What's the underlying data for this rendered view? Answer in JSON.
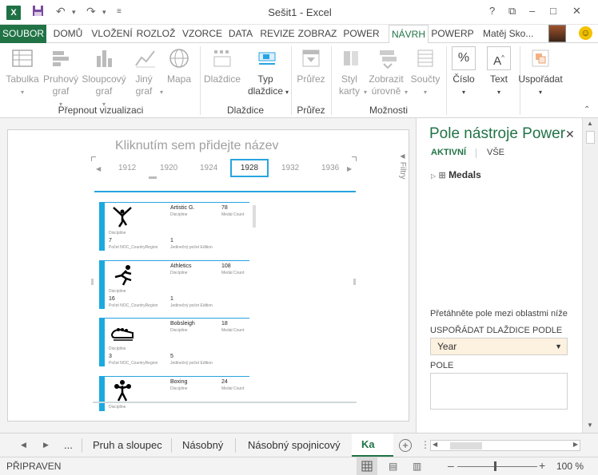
{
  "window": {
    "title": "Sešit1 - Excel",
    "help": "?",
    "minimize": "–",
    "restore": "□",
    "close": "✕",
    "ribbon_options": "⧉"
  },
  "menu": {
    "tabs": [
      "SOUBOR",
      "DOMŮ",
      "VLOŽENÍ",
      "ROZLOŽ",
      "VZORCE",
      "DATA",
      "REVIZE",
      "ZOBRAZ",
      "POWER",
      "NÁVRH",
      "POWERP"
    ],
    "active_tab": "NÁVRH",
    "user": "Matěj Sko..."
  },
  "ribbon": {
    "buttons": {
      "table": "Tabulka",
      "bar_chart": "Pruhový graf",
      "column_chart": "Sloupcový graf",
      "other_chart": "Jiný graf",
      "map": "Mapa",
      "tiles": "Dlaždice",
      "tile_type": "Typ dlaždice",
      "slicer": "Průřez",
      "card_style": "Styl karty",
      "show_levels": "Zobrazit úrovně",
      "totals": "Součty",
      "number": "Číslo",
      "text": "Text",
      "arrange": "Uspořádat"
    },
    "groups": {
      "switch_visualization": "Přepnout vizualizaci",
      "tiles": "Dlaždice",
      "slicer": "Průřez",
      "options": "Možnosti"
    }
  },
  "canvas": {
    "title_placeholder": "Kliknutím sem přidejte název",
    "filters_label": "Filtry",
    "timeline_years": [
      "1912",
      "1920",
      "1924",
      "1928",
      "1932",
      "1936"
    ],
    "selected_year": "1928"
  },
  "tiles": [
    {
      "name": "Artistic G.",
      "name_sub": "Discipline",
      "count": "78",
      "count_sub": "Medal Count",
      "discipline_label": "Discipline",
      "noc": "7",
      "noc_sub": "Počet NOC_CountryRegion",
      "edition": "1",
      "edition_sub": "Jedinečný počet Edition",
      "icon": "artistic-gymnastics-icon"
    },
    {
      "name": "Athletics",
      "name_sub": "Discipline",
      "count": "108",
      "count_sub": "Medal Count",
      "discipline_label": "Discipline",
      "noc": "16",
      "noc_sub": "Počet NOC_CountryRegion",
      "edition": "1",
      "edition_sub": "Jedinečný počet Edition",
      "icon": "athletics-icon"
    },
    {
      "name": "Bobsleigh",
      "name_sub": "Discipline",
      "count": "18",
      "count_sub": "Medal Count",
      "discipline_label": "Discipline",
      "noc": "3",
      "noc_sub": "Počet NOC_CountryRegion",
      "edition": "5",
      "edition_sub": "Jedinečný počet Edition",
      "icon": "bobsleigh-icon"
    },
    {
      "name": "Boxing",
      "name_sub": "Discipline",
      "count": "24",
      "count_sub": "Medal Count",
      "discipline_label": "Discipline",
      "icon": "boxing-icon"
    }
  ],
  "field_pane": {
    "title": "Pole nástroje Power View",
    "close": "✕",
    "tab_active": "AKTIVNÍ",
    "tab_all": "VŠE",
    "table_item": "Medals",
    "drag_hint": "Přetáhněte pole mezi oblastmi níže:",
    "sort_section": "USPOŘÁDAT DLAŽDICE PODLE",
    "sort_value": "Year",
    "fields_section": "POLE"
  },
  "sheet_tabs": {
    "ellipsis": "...",
    "tabs": [
      "Pruh a sloupec",
      "Násobný",
      "Násobný spojnicový",
      "Ka"
    ],
    "active": "Ka",
    "add": "+"
  },
  "status": {
    "ready": "PŘIPRAVEN",
    "zoom": "100 %"
  },
  "colors": {
    "excel_green": "#217346",
    "accent_blue": "#1ba9e0"
  }
}
